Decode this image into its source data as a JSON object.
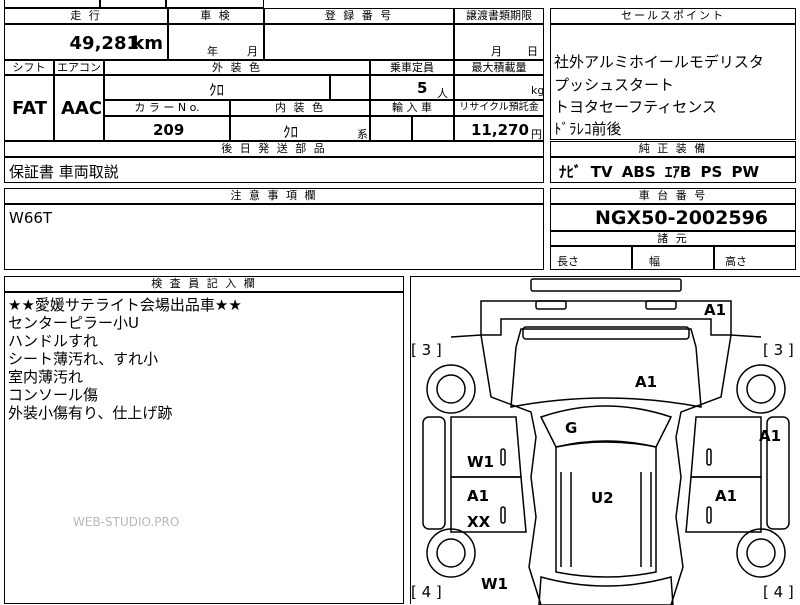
{
  "header": {
    "mileage_label": "走 行",
    "inspection_label": "車 検",
    "registration_label": "登 録 番 号",
    "transfer_deadline_label": "譲渡書類期限",
    "sales_point_label": "セールスポイント"
  },
  "mileage": {
    "value": "49,281",
    "unit": "km"
  },
  "inspection": {
    "year_unit": "年",
    "month_unit": "月"
  },
  "transfer_deadline": {
    "month_unit": "月",
    "day_unit": "日"
  },
  "sales_points": [
    "社外アルミホイールモデリスタ",
    "プッシュスタート",
    "トヨタセーフティセンス",
    "ﾄﾞﾗﾚｺ前後"
  ],
  "labels": {
    "shift": "シフト",
    "aircon": "エアコン",
    "exterior_color": "外 装 色",
    "capacity": "乗車定員",
    "max_load": "最大積載量",
    "color_no": "カ ラ ー N o.",
    "interior_color": "内 装 色",
    "import": "輸 入 車",
    "recycle": "リサイクル預託金",
    "delivered_later": "後 日 発 送 部 品",
    "standard_equipment": "純 正 装 備",
    "notes": "注 意 事 項 欄",
    "chassis_no": "車 台 番 号",
    "specs": "諸 元",
    "inspector_notes": "検 査 員 記 入 欄"
  },
  "shift": "FAT",
  "aircon": "AAC",
  "exterior_color": "ｸﾛ",
  "capacity": {
    "value": "5",
    "unit": "人"
  },
  "max_load": {
    "unit": "kg"
  },
  "color_no": "209",
  "interior_color": {
    "value": "ｸﾛ",
    "suffix": "系"
  },
  "recycle_fee": {
    "value": "11,270",
    "unit": "円"
  },
  "delivered_later_items": "保証書 車両取説",
  "standard_equipment": "ﾅﾋﾞ TV ABS ｴｱB PS PW",
  "notes_text": "W66T",
  "chassis_number": "NGX50-2002596",
  "specs": {
    "length": "長さ",
    "width": "幅",
    "height": "高さ"
  },
  "inspector_notes": [
    "★★愛媛サテライト会場出品車★★",
    "センターピラー小U",
    "ハンドルすれ",
    "シート薄汚れ、すれ小",
    "室内薄汚れ",
    "コンソール傷",
    "外装小傷有り、仕上げ跡"
  ],
  "watermark": "WEB-STUDIO.PRO",
  "diagram": {
    "marks": [
      "A1",
      "A1",
      "A1",
      "G",
      "W1",
      "A1",
      "U2",
      "A1",
      "XX",
      "W1"
    ],
    "tire_marks": [
      "[ 3 ]",
      "[ 3 ]",
      "[ 4 ]",
      "[ 4 ]"
    ]
  }
}
